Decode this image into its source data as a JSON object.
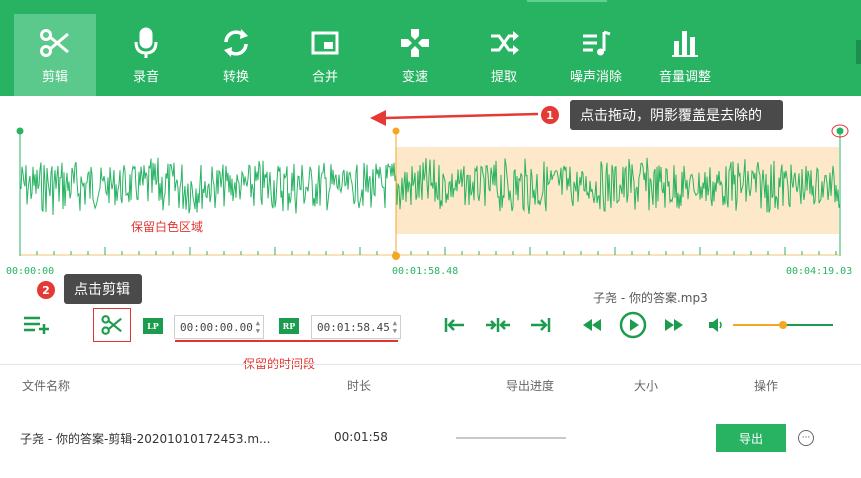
{
  "toolbar": {
    "tabs": [
      {
        "label": "剪辑",
        "icon": "scissors-icon",
        "active": true
      },
      {
        "label": "录音",
        "icon": "microphone-icon"
      },
      {
        "label": "转换",
        "icon": "convert-arrows-icon"
      },
      {
        "label": "合并",
        "icon": "merge-window-icon"
      },
      {
        "label": "变速",
        "icon": "gamepad-icon"
      },
      {
        "label": "提取",
        "icon": "shuffle-icon"
      },
      {
        "label": "噪声消除",
        "icon": "music-list-icon"
      },
      {
        "label": "音量调整",
        "icon": "bar-chart-icon"
      }
    ]
  },
  "waveform": {
    "start_time": "00:00:00",
    "cursor_time": "00:01:58.48",
    "end_time": "00:04:19.03",
    "keep_area_label": "保留白色区域",
    "selection_color": "#fde8c9",
    "wave_color": "#28b363"
  },
  "callouts": {
    "drag": {
      "number": "1",
      "text": "点击拖动，阴影覆盖是去除的"
    },
    "cut": {
      "number": "2",
      "text": "点击剪辑"
    },
    "keep_range": "保留的时间段"
  },
  "player": {
    "file_title": "子尧 - 你的答案.mp3",
    "lp_label": "LP",
    "rp_label": "RP",
    "lp_value": "00:00:00.00",
    "rp_value": "00:01:58.45"
  },
  "table": {
    "headers": {
      "name": "文件名称",
      "duration": "时长",
      "progress": "导出进度",
      "size": "大小",
      "action": "操作"
    },
    "rows": [
      {
        "name": "子尧 - 你的答案-剪辑-20201010172453.m...",
        "duration": "00:01:58",
        "export_label": "导出"
      }
    ]
  },
  "colors": {
    "accent": "#28b363",
    "annotation": "#e0342f",
    "selection": "#fde8c9",
    "cursor": "#f5a623"
  }
}
